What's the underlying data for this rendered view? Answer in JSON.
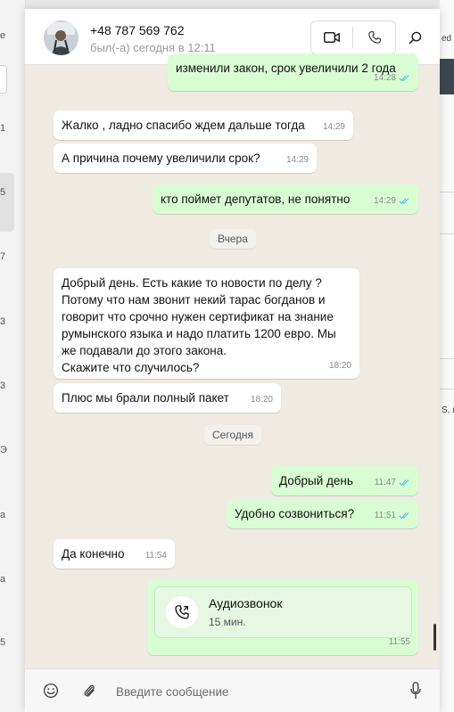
{
  "colors": {
    "chat_bg": "#efeae2",
    "incoming_bubble": "#ffffff",
    "outgoing_bubble": "#d9fdd3",
    "read_ticks": "#53bdeb"
  },
  "header": {
    "contact_name": "+48 787 569 762",
    "status": "был(-а) сегодня в 12:11",
    "icons": [
      "video-call-icon",
      "voice-call-icon",
      "search-icon"
    ]
  },
  "background": {
    "left_fragments": [
      "е",
      "1",
      "5",
      "7",
      "3",
      "3",
      "Э",
      "а",
      "а",
      "5"
    ],
    "right_fragments": [
      "ed l",
      "S, вы"
    ]
  },
  "messages": {
    "m0": {
      "text": "изменили закон, срок увеличили 2 года",
      "time": "14:28",
      "direction": "out",
      "status": "read"
    },
    "m1": {
      "text": "Жалко , ладно спасибо ждем дальше тогда",
      "time": "14:29",
      "direction": "in"
    },
    "m2": {
      "text": "А причина почему увеличили срок?",
      "time": "14:29",
      "direction": "in"
    },
    "m3": {
      "text": "кто поймет депутатов, не понятно",
      "time": "14:29",
      "direction": "out",
      "status": "read"
    },
    "d1": {
      "label": "Вчера"
    },
    "m4": {
      "text": "Добрый день. Есть какие то новости по делу ?\nПотому что нам звонит некий тарас богданов и\nговорит что срочно нужен сертификат на знание\nрумынского языка и надо платить 1200 евро. Мы\nже подавали до этого закона.\nСкажите что случилось?",
      "time": "18:20",
      "direction": "in"
    },
    "m5": {
      "text": "Плюс мы брали полный пакет",
      "time": "18:20",
      "direction": "in"
    },
    "d2": {
      "label": "Сегодня"
    },
    "m6": {
      "text": "Добрый день",
      "time": "11:47",
      "direction": "out",
      "status": "read"
    },
    "m7": {
      "text": "Удобно созвониться?",
      "time": "11:51",
      "direction": "out",
      "status": "read"
    },
    "m8": {
      "text": "Да конечно",
      "time": "11:54",
      "direction": "in"
    },
    "call": {
      "title": "Аудиозвонок",
      "duration": "15 мин.",
      "time": "11:55",
      "direction": "out"
    }
  },
  "composer": {
    "placeholder": "Введите сообщение",
    "value": ""
  }
}
